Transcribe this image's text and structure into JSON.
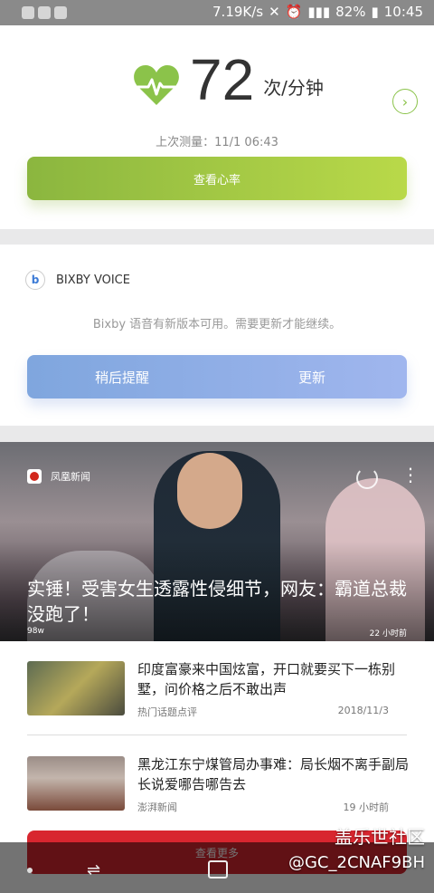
{
  "status_bar": {
    "speed": "7.19K/s",
    "battery": "82%",
    "time": "10:45"
  },
  "heart_rate": {
    "value": "72",
    "unit": "次/分钟",
    "last_measured": "上次测量：11/1 06:43",
    "button_label": "查看心率",
    "accent": "#8bc34a"
  },
  "bixby": {
    "title": "BIXBY VOICE",
    "message": "Bixby 语音有新版本可用。需要更新才能继续。",
    "later_label": "稍后提醒",
    "update_label": "更新"
  },
  "news": {
    "hero": {
      "source": "凤凰新闻",
      "title": "实锤！受害女生透露性侵细节，网友：霸道总裁没跑了！",
      "views": "98w",
      "time": "22 小时前"
    },
    "items": [
      {
        "title": "印度富豪来中国炫富，开口就要买下一栋别墅，问价格之后不敢出声",
        "source": "热门话题点评",
        "date": "2018/11/3"
      },
      {
        "title": "黑龙江东宁煤管局办事难：局长烟不离手副局长说爱哪告哪告去",
        "source": "澎湃新闻",
        "date": "19 小时前"
      }
    ],
    "more_label": "查看更多"
  },
  "watermark": {
    "line1": "盖乐世社区",
    "line2": "@GC_2CNAF9BH"
  }
}
